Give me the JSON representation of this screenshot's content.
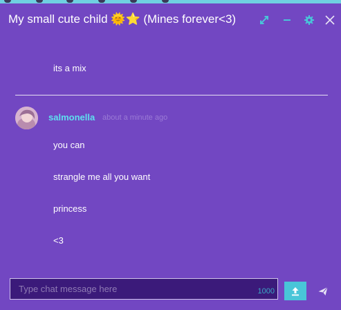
{
  "window": {
    "title": "My small cute child 🌞⭐ (Mines forever<3)",
    "icons": {
      "expand": "expand-icon",
      "minimize": "minimize-icon",
      "settings": "gear-icon",
      "close": "close-icon"
    }
  },
  "messages_before": [
    {
      "text": "its a mix"
    }
  ],
  "message_group": {
    "username": "salmonella",
    "timestamp": "about a minute ago",
    "lines": [
      {
        "text": "you can"
      },
      {
        "text": "strangle me all you want"
      },
      {
        "text": "princess"
      },
      {
        "text": "<3"
      }
    ]
  },
  "composer": {
    "placeholder": "Type chat message here",
    "char_limit": "1000",
    "upload_icon": "upload-icon",
    "send_icon": "send-icon"
  },
  "colors": {
    "background": "#7247c2",
    "accent": "#49c5d8",
    "username": "#5ee0ef"
  }
}
